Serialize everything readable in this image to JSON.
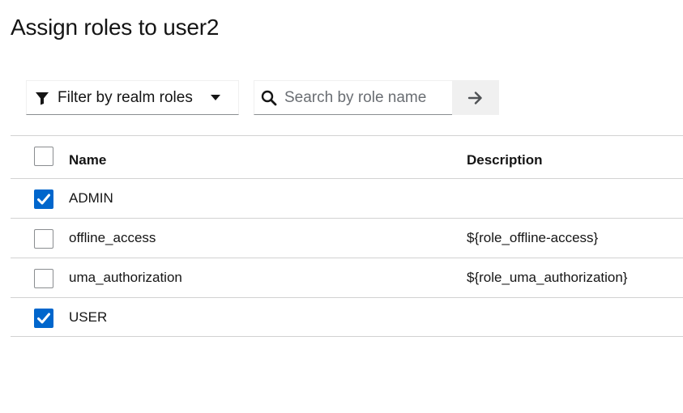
{
  "modal": {
    "title": "Assign roles to user2"
  },
  "toolbar": {
    "filter_label": "Filter by realm roles",
    "search_placeholder": "Search by role name",
    "search_value": ""
  },
  "table": {
    "columns": [
      "Name",
      "Description"
    ],
    "header_checked": false,
    "rows": [
      {
        "name": "ADMIN",
        "description": "",
        "checked": true
      },
      {
        "name": "offline_access",
        "description": "${role_offline-access}",
        "checked": false
      },
      {
        "name": "uma_authorization",
        "description": "${role_uma_authorization}",
        "checked": false
      },
      {
        "name": "USER",
        "description": "",
        "checked": true
      }
    ]
  },
  "colors": {
    "accent": "#0066cc",
    "border": "#d2d2d2"
  },
  "icons": [
    "filter-icon",
    "caret-down-icon",
    "search-icon",
    "arrow-right-icon",
    "checkmark-icon"
  ]
}
